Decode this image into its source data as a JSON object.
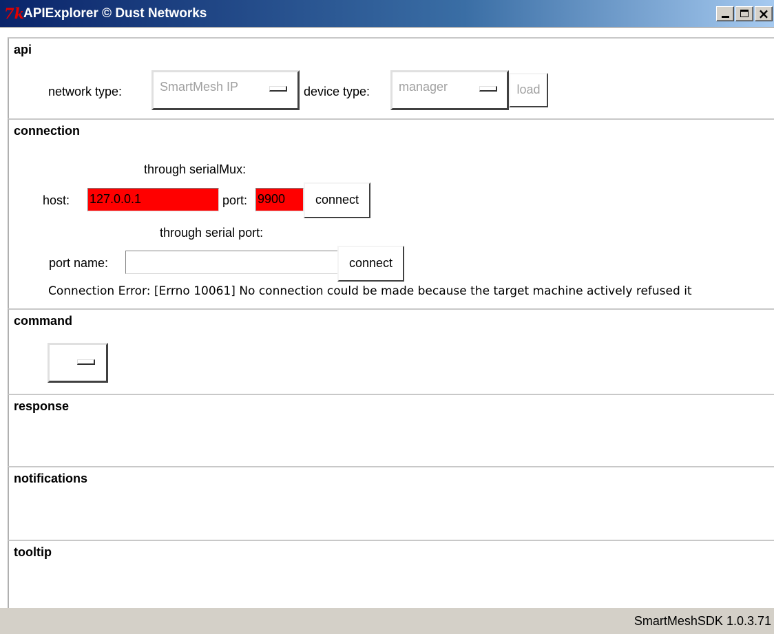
{
  "window": {
    "title": "APIExplorer © Dust Networks",
    "icon": "tk-feather-icon"
  },
  "api": {
    "title": "api",
    "network_type_label": "network type:",
    "network_type_value": "SmartMesh IP",
    "device_type_label": "device type:",
    "device_type_value": "manager",
    "load_label": "load"
  },
  "connection": {
    "title": "connection",
    "serialmux_heading": "through serialMux:",
    "host_label": "host:",
    "host_value": "127.0.0.1",
    "port_label": "port:",
    "port_value": "9900",
    "connect_label": "connect",
    "serial_heading": "through serial port:",
    "port_name_label": "port name:",
    "port_name_value": "",
    "serial_connect_label": "connect",
    "error_text": "Connection Error: [Errno 10061] No connection could be made because the target machine actively refused it"
  },
  "command": {
    "title": "command"
  },
  "response": {
    "title": "response"
  },
  "notifications": {
    "title": "notifications"
  },
  "tooltip": {
    "title": "tooltip"
  },
  "status": {
    "version": "SmartMeshSDK 1.0.3.71"
  },
  "colors": {
    "error_field": "#ff0000",
    "titlebar": "#0a246a"
  }
}
